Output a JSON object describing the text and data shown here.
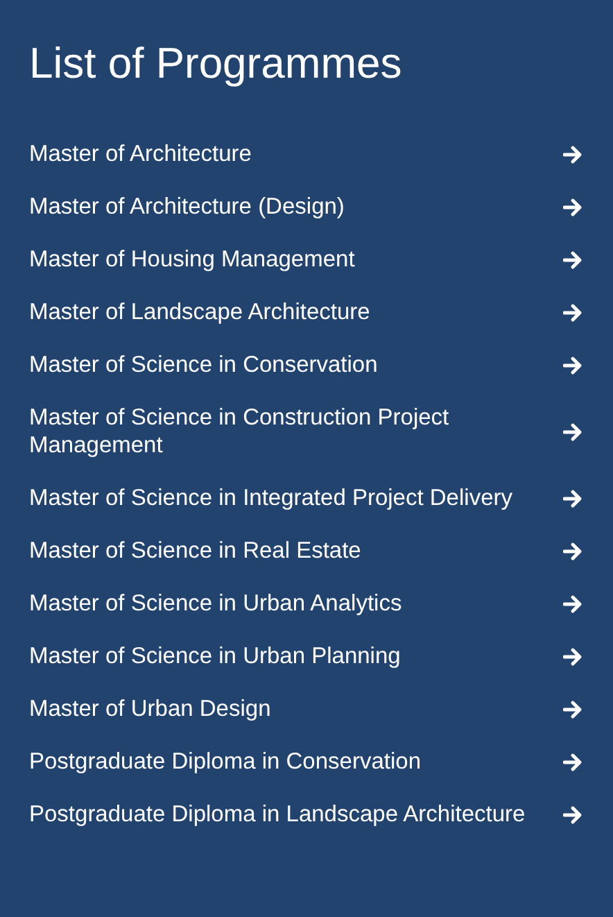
{
  "title": "List of Programmes",
  "programmes": [
    {
      "label": "Master of Architecture"
    },
    {
      "label": "Master of Architecture (Design)"
    },
    {
      "label": "Master of Housing Management"
    },
    {
      "label": "Master of Landscape Architecture"
    },
    {
      "label": "Master of Science in Conservation"
    },
    {
      "label": "Master of Science in Construction Project Management"
    },
    {
      "label": "Master of Science in Integrated Project Delivery"
    },
    {
      "label": "Master of Science in Real Estate"
    },
    {
      "label": "Master of Science in Urban Analytics"
    },
    {
      "label": "Master of Science in Urban Planning"
    },
    {
      "label": "Master of Urban Design"
    },
    {
      "label": "Postgraduate Diploma in Conservation"
    },
    {
      "label": "Postgraduate Diploma in Landscape Architecture"
    }
  ]
}
